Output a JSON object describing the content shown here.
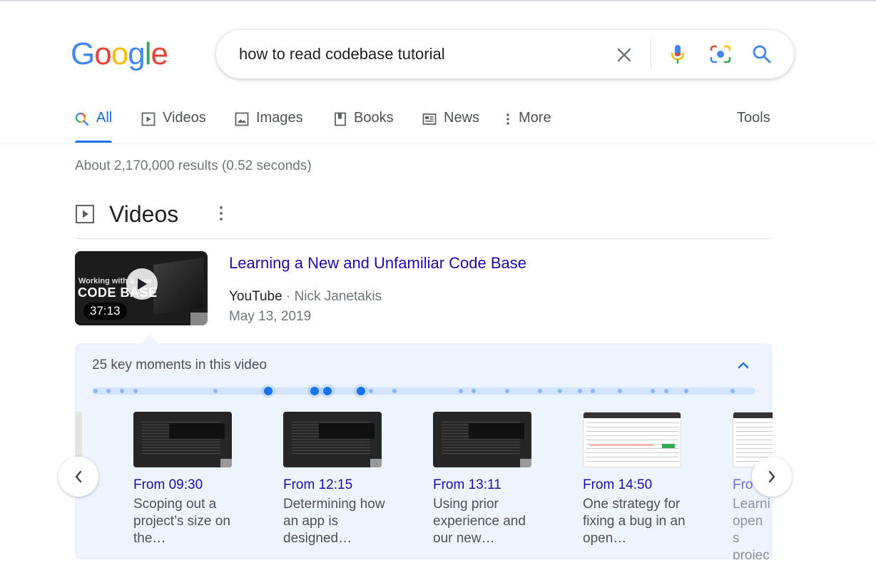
{
  "logo": "Google",
  "search": {
    "query": "how to read codebase tutorial"
  },
  "tabs": [
    {
      "label": "All"
    },
    {
      "label": "Videos"
    },
    {
      "label": "Images"
    },
    {
      "label": "Books"
    },
    {
      "label": "News"
    },
    {
      "label": "More"
    }
  ],
  "tools_label": "Tools",
  "result_stats": "About 2,170,000 results (0.52 seconds)",
  "videos_section": {
    "title": "Videos",
    "video": {
      "title": "Learning a New and Unfamiliar Code Base",
      "source": "YouTube",
      "separator": "·",
      "author": "Nick Janetakis",
      "date": "May 13, 2019",
      "duration": "37:13",
      "thumb_text_line1": "Working with a new",
      "thumb_text_line2": "CODE BASE"
    },
    "key_moments": {
      "title": "25 key moments in this video",
      "items": [
        {
          "from": "From 09:30",
          "desc": "Scoping out a project’s size on the…"
        },
        {
          "from": "From 12:15",
          "desc": "Determining how an app is designed…"
        },
        {
          "from": "From 13:11",
          "desc": "Using prior experience and our new…"
        },
        {
          "from": "From 14:50",
          "desc": "One strategy for fixing a bug in an open…"
        },
        {
          "from": "Fro",
          "desc": "Learni open s projec"
        }
      ]
    }
  },
  "colors": {
    "link": "#1a0dab",
    "accent": "#1a73e8",
    "panel_bg": "#eef4fd"
  },
  "icons": [
    "close-icon",
    "mic-icon",
    "lens-icon",
    "search-icon",
    "chevron-up-icon",
    "chevron-left-icon",
    "chevron-right-icon",
    "play-icon"
  ]
}
